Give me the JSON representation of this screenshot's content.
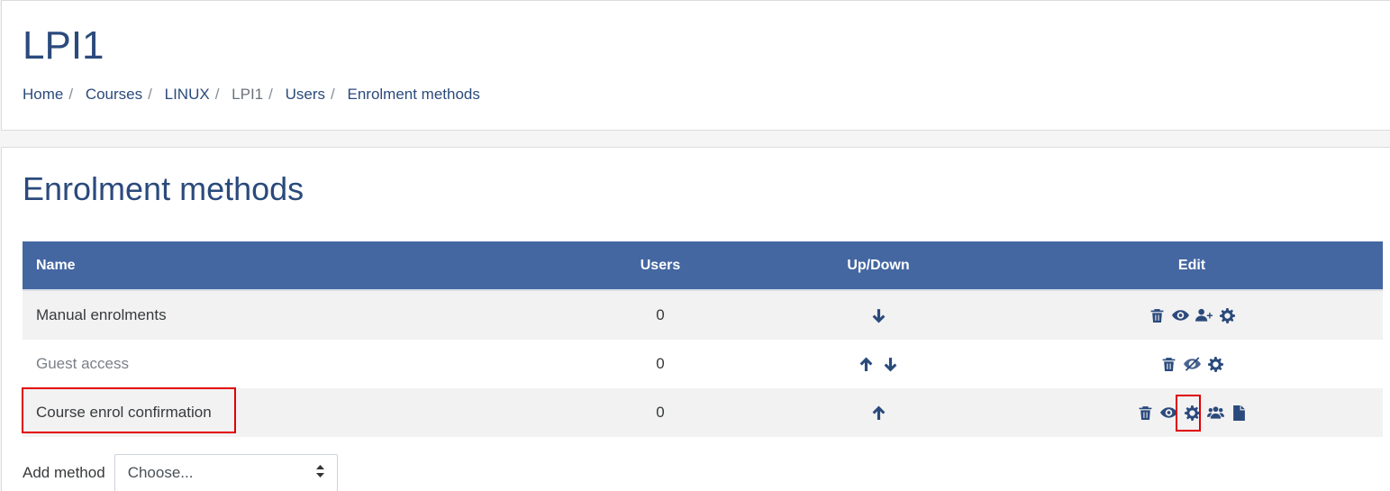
{
  "header": {
    "course_title": "LPI1",
    "breadcrumb": {
      "home": "Home",
      "courses": "Courses",
      "category": "LINUX",
      "course": "LPI1",
      "users": "Users",
      "current": "Enrolment methods",
      "separator": "/"
    }
  },
  "main": {
    "title": "Enrolment methods",
    "table": {
      "headers": {
        "name": "Name",
        "users": "Users",
        "updown": "Up/Down",
        "edit": "Edit"
      },
      "rows": [
        {
          "name": "Manual enrolments",
          "users": "0",
          "updown": [
            "arrow-down-icon"
          ],
          "edit": [
            "trash-icon",
            "eye-icon",
            "user-plus-icon",
            "gear-icon"
          ]
        },
        {
          "name": "Guest access",
          "users": "0",
          "updown": [
            "arrow-up-icon",
            "arrow-down-icon"
          ],
          "edit": [
            "trash-icon",
            "eye-slash-icon",
            "gear-icon"
          ],
          "disabled": true
        },
        {
          "name": "Course enrol confirmation",
          "users": "0",
          "updown": [
            "arrow-up-icon"
          ],
          "edit": [
            "trash-icon",
            "eye-icon",
            "gear-icon",
            "users-icon",
            "file-icon"
          ]
        }
      ]
    },
    "add_method": {
      "label": "Add method",
      "selected": "Choose..."
    }
  },
  "colors": {
    "brand": "#2b4a7c",
    "table_header": "#4467a2",
    "highlight": "#e00000"
  }
}
